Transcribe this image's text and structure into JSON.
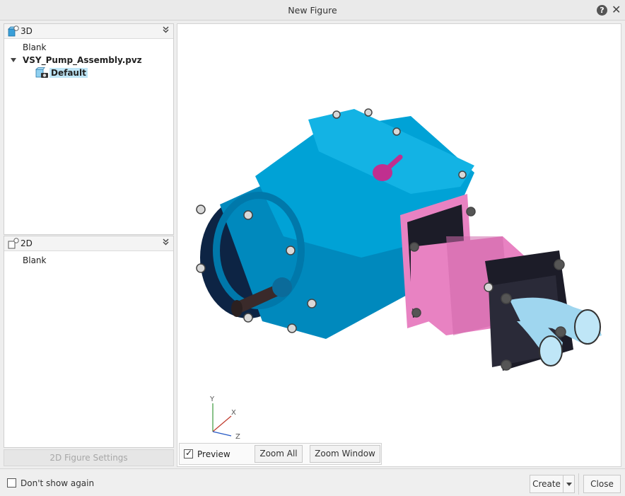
{
  "window": {
    "title": "New Figure",
    "help_icon": "?",
    "close_icon": "✕"
  },
  "section_3d": {
    "title": "3D",
    "items": [
      {
        "label": "Blank"
      },
      {
        "label": "VSY_Pump_Assembly.pvz",
        "expanded": true
      },
      {
        "label": "Default",
        "selected": true
      }
    ]
  },
  "section_2d": {
    "title": "2D",
    "items": [
      {
        "label": "Blank"
      }
    ]
  },
  "settings_button": {
    "label": "2D Figure Settings",
    "enabled": false
  },
  "viewer": {
    "axes": {
      "y": "Y",
      "x": "X",
      "z": "Z"
    },
    "preview": {
      "label": "Preview",
      "checked": true
    },
    "zoom_all_label": "Zoom All",
    "zoom_window_label": "Zoom Window"
  },
  "footer": {
    "dont_show_label": "Don't show again",
    "dont_show_checked": false,
    "create_label": "Create",
    "close_label": "Close"
  },
  "colors": {
    "housing": "#00a2d6",
    "pink": "#e882c2",
    "dark": "#1c1c28",
    "light_blue": "#9fd6ef",
    "selection": "#bfe6f7"
  },
  "icons": {
    "section_3d_icon": "3d-model-icon",
    "section_2d_icon": "2d-drawing-icon",
    "collapse": "chevron-double-down-icon",
    "default_view": "camera-view-icon"
  }
}
